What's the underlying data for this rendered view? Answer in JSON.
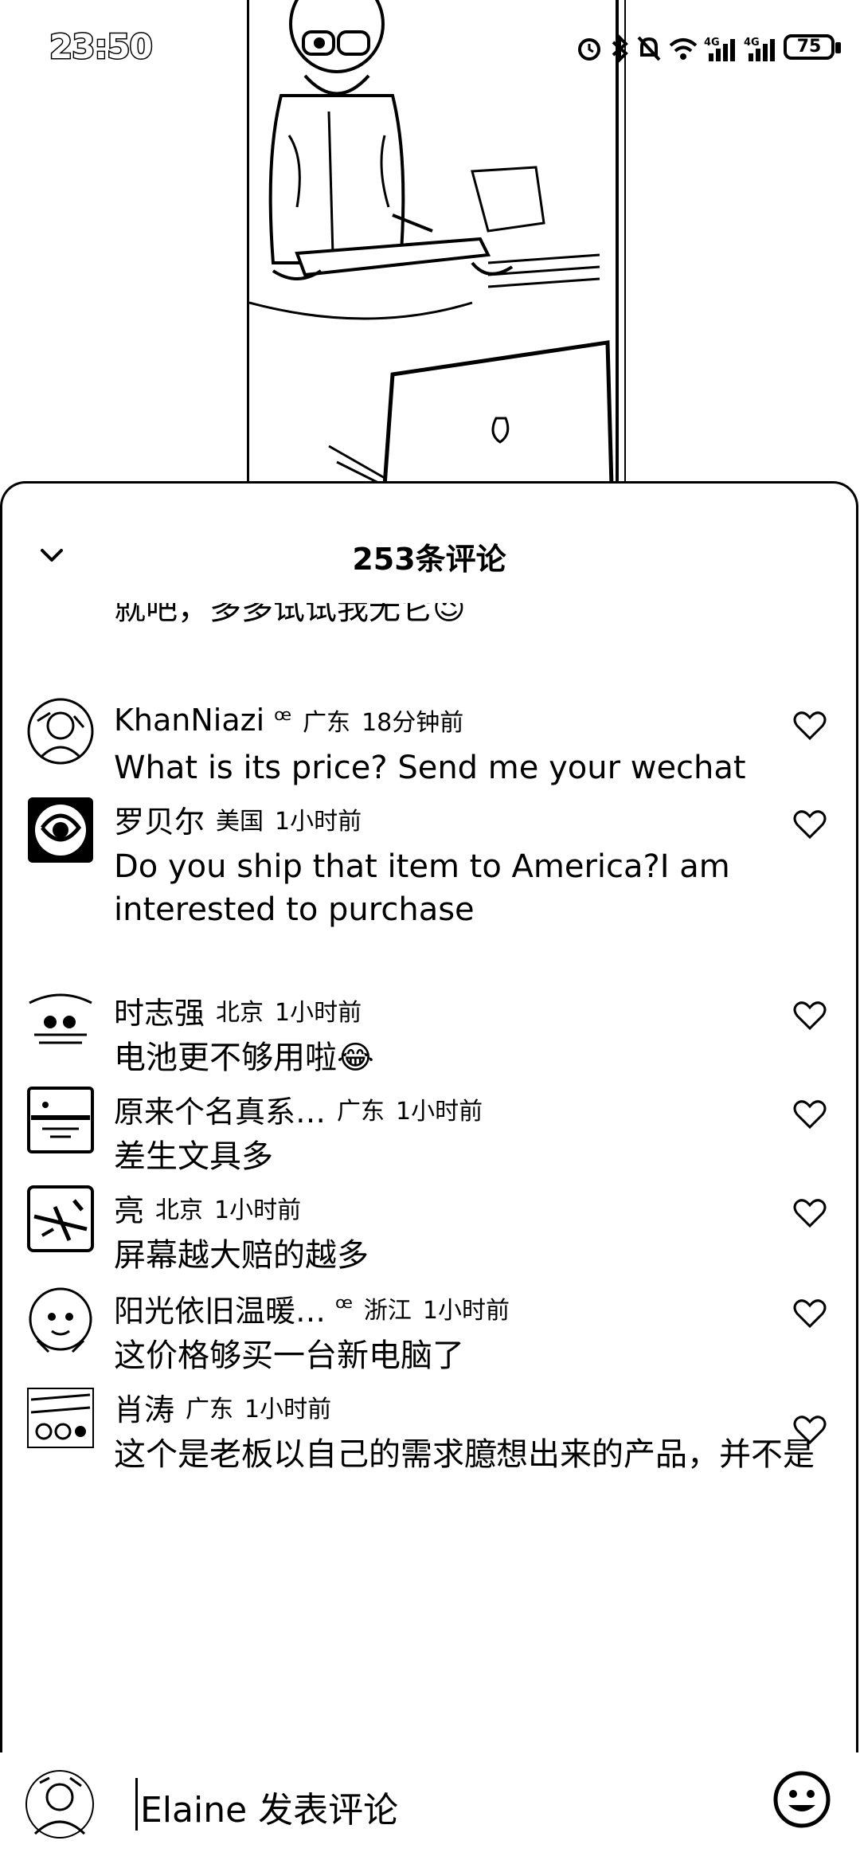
{
  "status_bar": {
    "time": "23:50",
    "battery": "75",
    "icons": [
      "alarm-icon",
      "bluetooth-icon",
      "mute-icon",
      "wifi-icon",
      "signal-4g-icon",
      "signal-4g-icon",
      "battery-icon"
    ]
  },
  "sheet": {
    "title": "253条评论",
    "collapse_icon": "chevron-down-icon",
    "cut_off_text": "就吧，多多试试我无它😉"
  },
  "comments": [
    {
      "username": "KhanNiazi",
      "badge": "ꟹ",
      "location": "广东",
      "time": "18分钟前",
      "text": "What is its price? Send me your wechat"
    },
    {
      "username": "罗贝尔",
      "badge": "",
      "location": "美国",
      "time": "1小时前",
      "text": "Do you ship that item to America?I am interested to purchase"
    },
    {
      "username": "时志强",
      "badge": "",
      "location": "北京",
      "time": "1小时前",
      "text": "电池更不够用啦😂"
    },
    {
      "username": "原来个名真系…",
      "badge": "",
      "location": "广东",
      "time": "1小时前",
      "text": "差生文具多"
    },
    {
      "username": "亮",
      "badge": "",
      "location": "北京",
      "time": "1小时前",
      "text": "屏幕越大赔的越多"
    },
    {
      "username": "阳光依旧温暖…",
      "badge": "ꟹ",
      "location": "浙江",
      "time": "1小时前",
      "text": "这价格够买一台新电脑了"
    },
    {
      "username": "肖涛",
      "badge": "",
      "location": "广东",
      "time": "1小时前",
      "text": "这个是老板以自己的需求臆想出来的产品，并不是用户的需求，高端用户别说用笔记本，就是用个手"
    }
  ],
  "input_bar": {
    "placeholder": "Elaine 发表评论",
    "emoji_icon": "smiley-icon"
  }
}
